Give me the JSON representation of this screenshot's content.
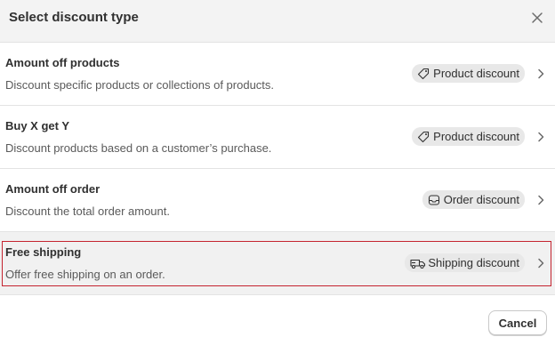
{
  "dialog": {
    "title": "Select discount type",
    "cancel_label": "Cancel"
  },
  "options": [
    {
      "title": "Amount off products",
      "description": "Discount specific products or collections of products.",
      "badge": "Product discount",
      "badge_icon": "tag-icon",
      "selected": false
    },
    {
      "title": "Buy X get Y",
      "description": "Discount products based on a customer’s purchase.",
      "badge": "Product discount",
      "badge_icon": "tag-icon",
      "selected": false
    },
    {
      "title": "Amount off order",
      "description": "Discount the total order amount.",
      "badge": "Order discount",
      "badge_icon": "order-icon",
      "selected": false
    },
    {
      "title": "Free shipping",
      "description": "Offer free shipping on an order.",
      "badge": "Shipping discount",
      "badge_icon": "truck-icon",
      "selected": true
    }
  ],
  "colors": {
    "header_bg": "#f3f3f3",
    "selected_row_bg": "#f1f1f1",
    "selection_outline": "#c4232f",
    "badge_bg": "#e8e8e8"
  }
}
